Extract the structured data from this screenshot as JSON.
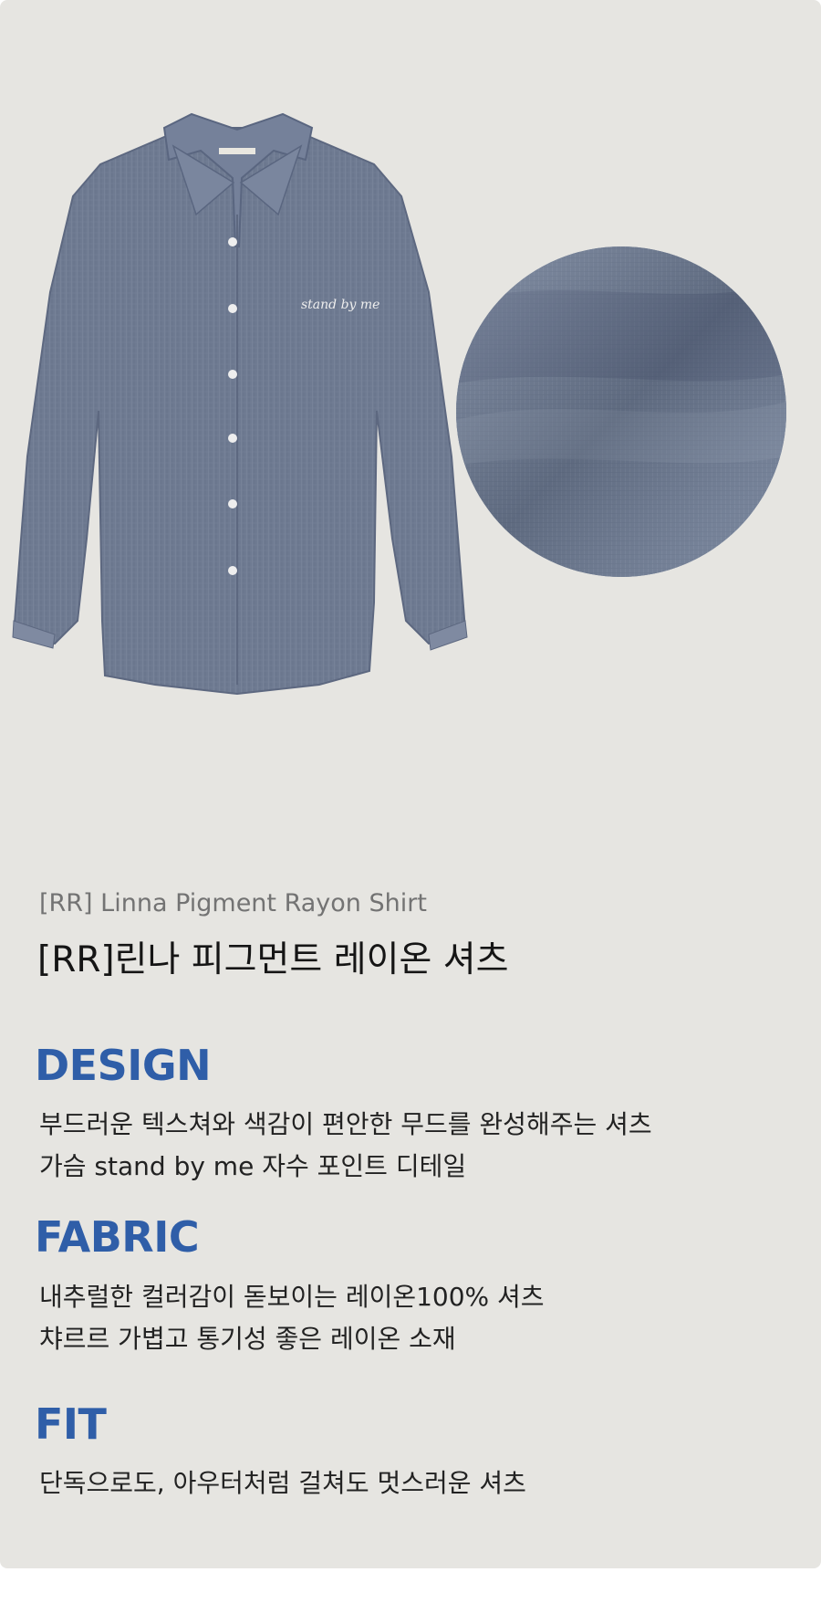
{
  "product": {
    "name_en": "[RR] Linna Pigment Rayon Shirt",
    "name_ko": "[RR]린나 피그먼트 레이온 셔츠"
  },
  "hero": {
    "shirt_embroidery": "stand by me",
    "shirt_color": "#6e7a91",
    "fabric_swatch_color": "#6f7d96"
  },
  "sections": {
    "design": {
      "title": "DESIGN",
      "lines": [
        "부드러운 텍스쳐와 색감이 편안한 무드를 완성해주는 셔츠",
        "가슴 stand by me 자수 포인트 디테일"
      ]
    },
    "fabric": {
      "title": "FABRIC",
      "lines": [
        "내추럴한 컬러감이 돋보이는 레이온100% 셔츠",
        "챠르르 가볍고 통기성 좋은 레이온 소재"
      ]
    },
    "fit": {
      "title": "FIT",
      "lines": [
        "단독으로도, 아우터처럼 걸쳐도 멋스러운 셔츠"
      ]
    }
  },
  "colors": {
    "background": "#e6e5e1",
    "accent": "#2f5ea8"
  }
}
